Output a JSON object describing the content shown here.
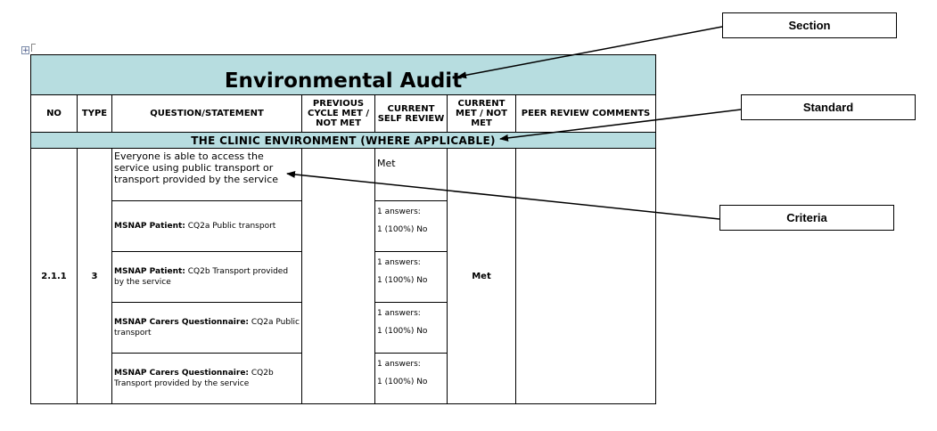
{
  "table": {
    "title": "Environmental Audit",
    "headers": {
      "no": "NO",
      "type": "TYPE",
      "question": "QUESTION/STATEMENT",
      "previous": "PREVIOUS CYCLE MET / NOT MET",
      "self_review": "CURRENT SELF REVIEW",
      "current_met": "CURRENT MET / NOT MET",
      "peer": "PEER REVIEW COMMENTS"
    },
    "standard": "THE CLINIC ENVIRONMENT (WHERE APPLICABLE)",
    "criterion": {
      "no": "2.1.1",
      "type": "3",
      "question": "Everyone is able to access the service using public transport or transport provided by the service",
      "self_review": "Met",
      "current_met": "Met",
      "sub_rows": [
        {
          "source": "MSNAP Patient:",
          "text": " CQ2a Public transport",
          "answers": "1 answers:",
          "result": "1 (100%) No"
        },
        {
          "source": "MSNAP Patient:",
          "text": " CQ2b Transport provided by the service",
          "answers": "1 answers:",
          "result": "1 (100%) No"
        },
        {
          "source": "MSNAP Carers Questionnaire:",
          "text": " CQ2a Public transport",
          "answers": "1 answers:",
          "result": "1 (100%) No"
        },
        {
          "source": "MSNAP Carers Questionnaire:",
          "text": " CQ2b Transport provided by the service",
          "answers": "1 answers:",
          "result": "1 (100%) No"
        }
      ]
    }
  },
  "callouts": {
    "section": "Section",
    "standard": "Standard",
    "criteria": "Criteria"
  }
}
